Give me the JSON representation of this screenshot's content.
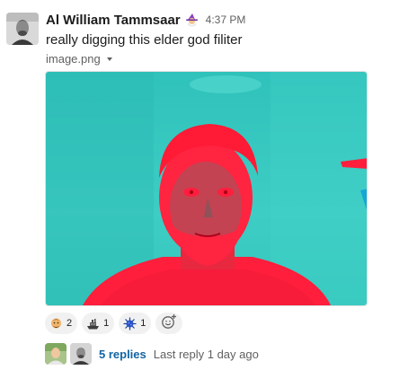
{
  "message": {
    "author": "Al William Tammsaar",
    "status_emoji": "wizard-emoji",
    "timestamp": "4:37 PM",
    "text": "really digging this elder god filiter",
    "file": {
      "name": "image.png",
      "icon": "chevron-down-icon"
    }
  },
  "reactions": [
    {
      "emoji": "bearded-person-emoji",
      "count": "2"
    },
    {
      "emoji": "ship-emoji",
      "count": "1"
    },
    {
      "emoji": "virus-emoji",
      "count": "1"
    }
  ],
  "add_reaction_icon": "add-emoji-icon",
  "thread": {
    "replies": "5 replies",
    "last_reply": "Last reply 1 day ago"
  },
  "colors": {
    "link": "#1264a3",
    "image_bg": "#36c9c0",
    "image_red": "#ff1e3c"
  }
}
